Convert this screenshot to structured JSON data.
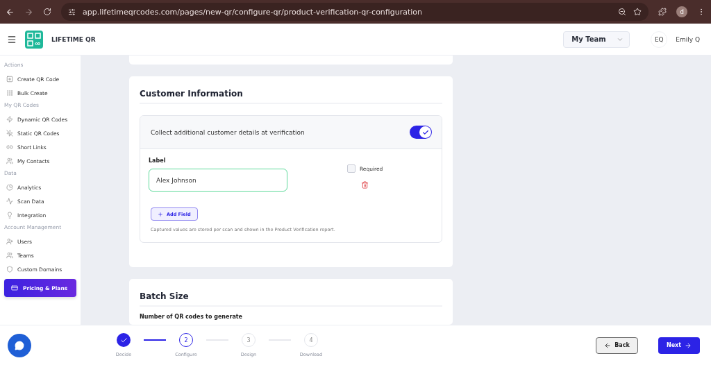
{
  "browser": {
    "url": "app.lifetimeqrcodes.com/pages/new-qr/configure-qr/product-verification-qr-configuration",
    "profile": "d"
  },
  "header": {
    "brand": "LIFETIME QR",
    "team": "My Team",
    "user_initials": "EQ",
    "user_name": "Emily Q"
  },
  "sidebar": {
    "sections": [
      {
        "title": "Actions",
        "items": [
          {
            "label": "Create QR Code"
          },
          {
            "label": "Bulk Create"
          }
        ]
      },
      {
        "title": "My QR Codes",
        "items": [
          {
            "label": "Dynamic QR Codes"
          },
          {
            "label": "Static QR Codes"
          },
          {
            "label": "Short Links"
          },
          {
            "label": "My Contacts"
          }
        ]
      },
      {
        "title": "Data",
        "items": [
          {
            "label": "Analytics"
          },
          {
            "label": "Scan Data"
          },
          {
            "label": "Integration"
          }
        ]
      },
      {
        "title": "Account Management",
        "items": [
          {
            "label": "Users"
          },
          {
            "label": "Teams"
          },
          {
            "label": "Custom Domains"
          }
        ]
      }
    ],
    "cta": "Pricing & Plans"
  },
  "customer_information": {
    "title": "Customer Information",
    "toggle_label": "Collect additional customer details at verification",
    "on": true,
    "field_label": "Label",
    "field_value": "Alex Johnson",
    "required_label": "Required",
    "required_checked": false,
    "add_button": "Add Field",
    "note": "Captured values are stored per scan and shown in the Product Verification report."
  },
  "batch_size": {
    "title": "Batch Size",
    "field_label": "Number of QR codes to generate"
  },
  "stepper": [
    {
      "label": "Decide",
      "completed": true,
      "selected": false
    },
    {
      "number": "2",
      "label": "Configure",
      "completed": false,
      "selected": true
    },
    {
      "number": "3",
      "label": "Design",
      "completed": false,
      "selected": false
    },
    {
      "number": "4",
      "label": "Download",
      "completed": false,
      "selected": false
    }
  ],
  "back_button": "Back",
  "next_button": "Next"
}
